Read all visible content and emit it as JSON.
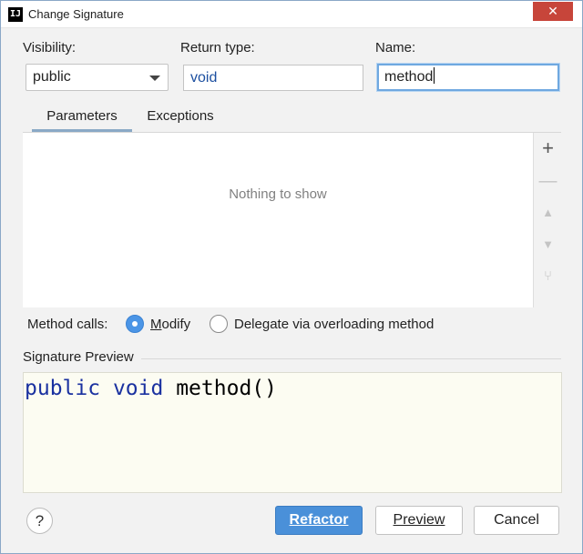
{
  "window": {
    "title": "Change Signature",
    "app_icon_glyph": "IJ",
    "close_glyph": "✕"
  },
  "fields": {
    "visibility_label": "Visibility:",
    "visibility_value": "public",
    "return_type_label": "Return type:",
    "return_type_value": "void",
    "name_label": "Name:",
    "name_value": "method"
  },
  "tabs": [
    {
      "label": "Parameters",
      "active": true
    },
    {
      "label": "Exceptions",
      "active": false
    }
  ],
  "parameters": {
    "empty_text": "Nothing to show",
    "toolbar_icons": [
      "add-icon",
      "remove-icon",
      "move-up-icon",
      "move-down-icon",
      "propagate-icon"
    ],
    "toolbar_glyphs": {
      "add": "+",
      "remove": "—",
      "up": "▲",
      "down": "▼",
      "propagate": "⑂"
    }
  },
  "method_calls": {
    "label": "Method calls:",
    "options": [
      {
        "label": "Modify",
        "checked": true
      },
      {
        "label": "Delegate via overloading method",
        "checked": false
      }
    ]
  },
  "signature_preview": {
    "title": "Signature Preview",
    "modifier": "public",
    "return_type": "void",
    "method_name": "method()"
  },
  "buttons": {
    "help": "?",
    "refactor": "Refactor",
    "preview": "Preview",
    "cancel": "Cancel"
  },
  "colors": {
    "accent": "#4a90d9",
    "keyword": "#1a31a0",
    "close": "#c7453a",
    "preview_bg": "#fcfcf2"
  }
}
